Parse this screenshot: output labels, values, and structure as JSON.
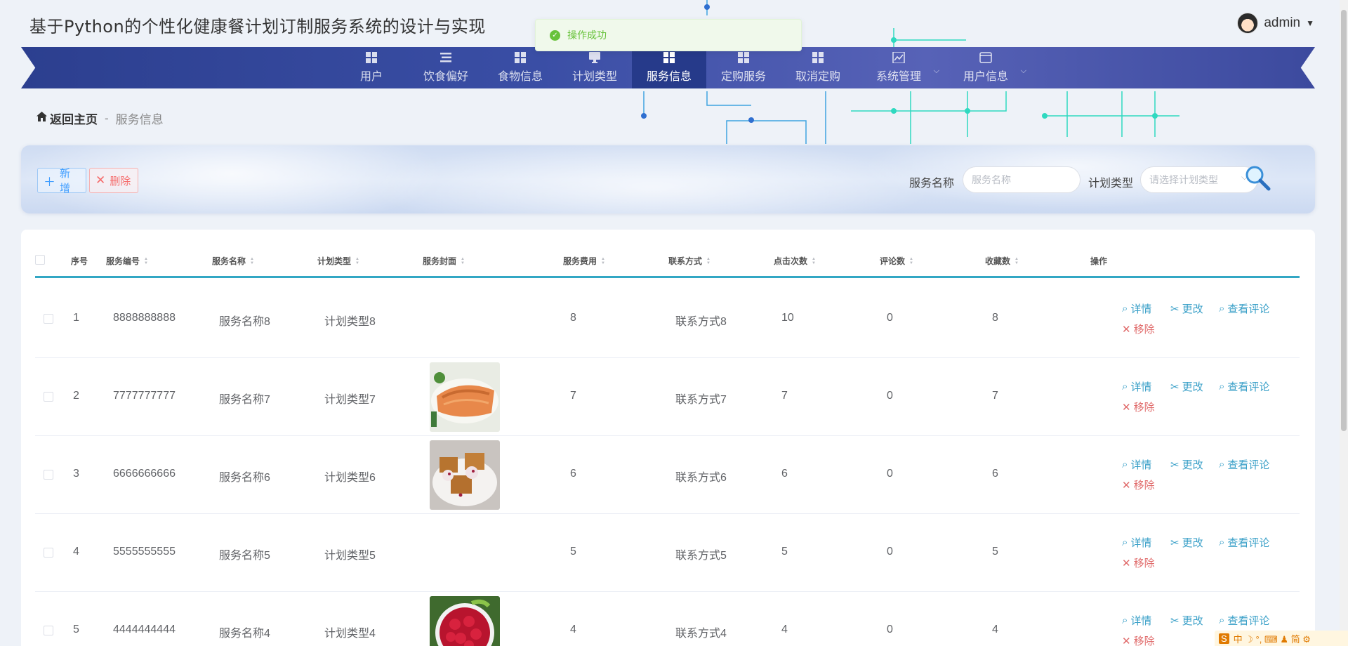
{
  "app": {
    "title": "基于Python的个性化健康餐计划订制服务系统的设计与实现",
    "user": "admin"
  },
  "toast": {
    "message": "操作成功"
  },
  "nav": {
    "items": [
      {
        "label": "用户",
        "icon": "grid-icon"
      },
      {
        "label": "饮食偏好",
        "icon": "list-icon"
      },
      {
        "label": "食物信息",
        "icon": "grid-icon"
      },
      {
        "label": "计划类型",
        "icon": "monitor-icon"
      },
      {
        "label": "服务信息",
        "icon": "grid-icon",
        "active": true
      },
      {
        "label": "定购服务",
        "icon": "grid-icon"
      },
      {
        "label": "取消定购",
        "icon": "grid-icon"
      },
      {
        "label": "系统管理",
        "icon": "chart-icon",
        "has_dropdown": true
      },
      {
        "label": "用户信息",
        "icon": "card-icon",
        "has_dropdown": true
      }
    ]
  },
  "breadcrumb": {
    "home": "返回主页",
    "separator": "-",
    "current": "服务信息"
  },
  "toolbar": {
    "add_label": "新增",
    "delete_label": "删除",
    "service_name_label": "服务名称",
    "service_name_placeholder": "服务名称",
    "plan_type_label": "计划类型",
    "plan_type_placeholder": "请选择计划类型"
  },
  "table": {
    "columns": [
      "序号",
      "服务编号",
      "服务名称",
      "计划类型",
      "服务封面",
      "服务费用",
      "联系方式",
      "点击次数",
      "评论数",
      "收藏数",
      "操作"
    ],
    "actions": {
      "detail": "详情",
      "edit": "更改",
      "comments": "查看评论",
      "remove": "移除"
    },
    "rows": [
      {
        "index": "1",
        "code": "8888888888",
        "name": "服务名称8",
        "plan": "计划类型8",
        "cover": "none",
        "fee": "8",
        "contact": "联系方式8",
        "clicks": "10",
        "comments": "0",
        "favorites": "8"
      },
      {
        "index": "2",
        "code": "7777777777",
        "name": "服务名称7",
        "plan": "计划类型7",
        "cover": "salmon",
        "fee": "7",
        "contact": "联系方式7",
        "clicks": "7",
        "comments": "0",
        "favorites": "7"
      },
      {
        "index": "3",
        "code": "6666666666",
        "name": "服务名称6",
        "plan": "计划类型6",
        "cover": "waffles",
        "fee": "6",
        "contact": "联系方式6",
        "clicks": "6",
        "comments": "0",
        "favorites": "6"
      },
      {
        "index": "4",
        "code": "5555555555",
        "name": "服务名称5",
        "plan": "计划类型5",
        "cover": "none",
        "fee": "5",
        "contact": "联系方式5",
        "clicks": "5",
        "comments": "0",
        "favorites": "5"
      },
      {
        "index": "5",
        "code": "4444444444",
        "name": "服务名称4",
        "plan": "计划类型4",
        "cover": "raspberries",
        "fee": "4",
        "contact": "联系方式4",
        "clicks": "4",
        "comments": "0",
        "favorites": "4"
      }
    ]
  },
  "ime": {
    "text": "中 ☽ °, ⌨ ♟ 简 ⚙"
  }
}
